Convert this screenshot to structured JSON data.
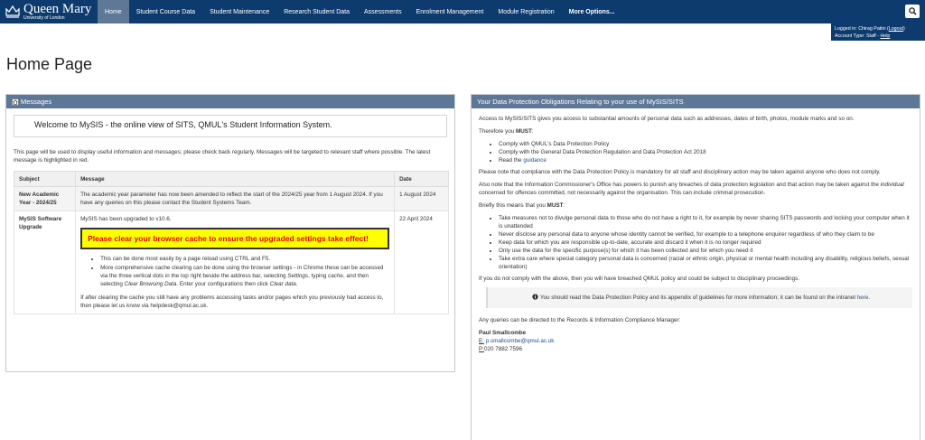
{
  "header": {
    "logo_main": "Queen Mary",
    "logo_sub": "University of London",
    "nav": [
      {
        "label": "Home"
      },
      {
        "label": "Student Course Data"
      },
      {
        "label": "Student Maintenance"
      },
      {
        "label": "Research Student Data"
      },
      {
        "label": "Assessments"
      },
      {
        "label": "Enrolment Management"
      },
      {
        "label": "Module Registration"
      },
      {
        "label": "More Options..."
      }
    ],
    "login_prefix": "Logged in: Chirag Patini (",
    "logout": "Logout",
    "login_suffix": ")",
    "account_prefix": "Account Type: Staff - ",
    "help": "Help"
  },
  "page_title": "Home Page",
  "messages": {
    "title": "Messages",
    "welcome": "Welcome to MySIS - the online view of SITS, QMUL's Student Information System.",
    "intro": "This page will be used to display useful information and messages; please check back regularly. Messages will be targeted to relevant staff where possible. The latest message is highlighted in red.",
    "headers": {
      "subject": "Subject",
      "message": "Message",
      "date": "Date"
    },
    "row1": {
      "subject": "New Academic Year - 2024/25",
      "message": "The academic year parameter has now been amended to reflect the start of the 2024/25 year from 1 August 2024. If you have any queries on this please contact the Student Systems Team.",
      "date": "1 August 2024"
    },
    "row2": {
      "subject": "MySIS Software Upgrade",
      "message": "MySIS has been upgraded to v10.6.",
      "alert": "Please clear your browser cache to ensure the upgraded settings take effect!",
      "bullet1": "This can be done most easily by a page reload using CTRL and F5.",
      "bullet2_a": "More comprehensive cache clearing can be done using the browser settings - in Chrome these can be accessed via the three vertical dots in the top right beside the address bar, selecting ",
      "bullet2_settings": "Settings",
      "bullet2_b": ", typing ",
      "bullet2_cache": "cache",
      "bullet2_c": ", and then selecting ",
      "bullet2_clear": "Clear Browsing Data",
      "bullet2_d": ". Enter your configurations then click ",
      "bullet2_cleardata": "Clear data",
      "bullet2_e": ".",
      "after": "If after clearing the cache you still have any problems accessing tasks and/or pages which you previously had access to, then please let us know via helpdesk@qmul.ac.uk.",
      "date": "22 April 2024"
    }
  },
  "dp": {
    "title": "Your Data Protection Obligations Relating to your use of MySIS/SITS",
    "p1": "Access to MySIS/SITS gives you access to substantial amounts of personal data such as addresses, dates of birth, photos, module marks and so on.",
    "p2_a": "Therefore you ",
    "must": "MUST",
    "colon": ":",
    "list1": [
      "Comply with QMUL's Data Protection Policy",
      "Comply with the General Data Protection Regulation and Data Protection Act 2018"
    ],
    "read_the": "Read the ",
    "guidance": "guidance",
    "p3": "Please note that compliance with the Data Protection Policy is mandatory for all staff and disciplinary action may be taken against anyone who does not comply.",
    "p4_a": "Also note that the Information Commissioner's Office has powers to punish any breaches of data protection legislation and that action may be taken against the ",
    "p4_individual": "individual",
    "p4_b": " concerned for offences committed, not necessarily against the organisation. This can include criminal prosecution.",
    "p5_a": "Briefly this means that you ",
    "list2": [
      "Take measures not to divulge personal data to those who do not have a right to it, for example by never sharing SITS passwords and locking your computer when it is unattended",
      "Never disclose any personal data to anyone whose identity cannot be verified, for example to a telephone enquirer regardless of who they claim to be",
      "Keep data for which you are responsible up-to-date, accurate and discard it when it is no longer required",
      "Only use the data for the specific purpose(s) for which it has been collected and for which you need it",
      "Take extra care where special category personal data is concerned (racial or ethnic origin, physical or mental health including any disability, religious beliefs, sexual orientation)"
    ],
    "p6": "If you do not comply with the above, then you will have breached QMUL policy and could be subject to disciplinary proceedings.",
    "note_a": "You should read the Data Protection Policy and its appendix of guidelines for more information; it can be found on the intranet ",
    "note_here": "here",
    "note_b": ".",
    "p7": "Any queries can be directed to the Records & Information Compliance Manager:",
    "contact_name": "Paul Smallcombe",
    "email_label": "E:",
    "email": "p.smallcombe@qmul.ac.uk",
    "phone_label": "P:",
    "phone": "020 7882 7596"
  }
}
